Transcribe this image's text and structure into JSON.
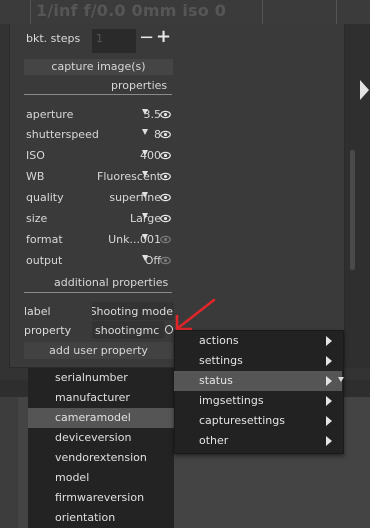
{
  "top_bar": {
    "title": "1/inf f/0.0 0mm iso 0"
  },
  "bracket": {
    "label": "bkt. steps",
    "value": "1",
    "minus": "−",
    "plus": "+"
  },
  "capture_button": "capture image(s)",
  "properties_header": "properties",
  "properties": [
    {
      "label": "aperture",
      "value": "3.5"
    },
    {
      "label": "shutterspeed",
      "value": "8"
    },
    {
      "label": "ISO",
      "value": "400"
    },
    {
      "label": "WB",
      "value": "Fluorescent"
    },
    {
      "label": "quality",
      "value": "superfine"
    },
    {
      "label": "size",
      "value": "Large"
    },
    {
      "label": "format",
      "value": "Unk...001"
    },
    {
      "label": "output",
      "value": "Off"
    }
  ],
  "additional_header": "additional properties",
  "label_field": {
    "label": "label",
    "value": "Shooting mode"
  },
  "property_field": {
    "label": "property",
    "value": "shootingmc"
  },
  "add_user_property_button": "add user property",
  "menu": [
    {
      "label": "actions"
    },
    {
      "label": "settings"
    },
    {
      "label": "status"
    },
    {
      "label": "imgsettings"
    },
    {
      "label": "capturesettings"
    },
    {
      "label": "other"
    }
  ],
  "list": [
    {
      "label": "serialnumber"
    },
    {
      "label": "manufacturer"
    },
    {
      "label": "cameramodel"
    },
    {
      "label": "deviceversion"
    },
    {
      "label": "vendorextension"
    },
    {
      "label": "model"
    },
    {
      "label": "firmwareversion"
    },
    {
      "label": "orientation"
    }
  ],
  "colors": {
    "annotation_arrow": "#e0262a",
    "selection": "#555555",
    "panel": "#3a3a3a"
  }
}
